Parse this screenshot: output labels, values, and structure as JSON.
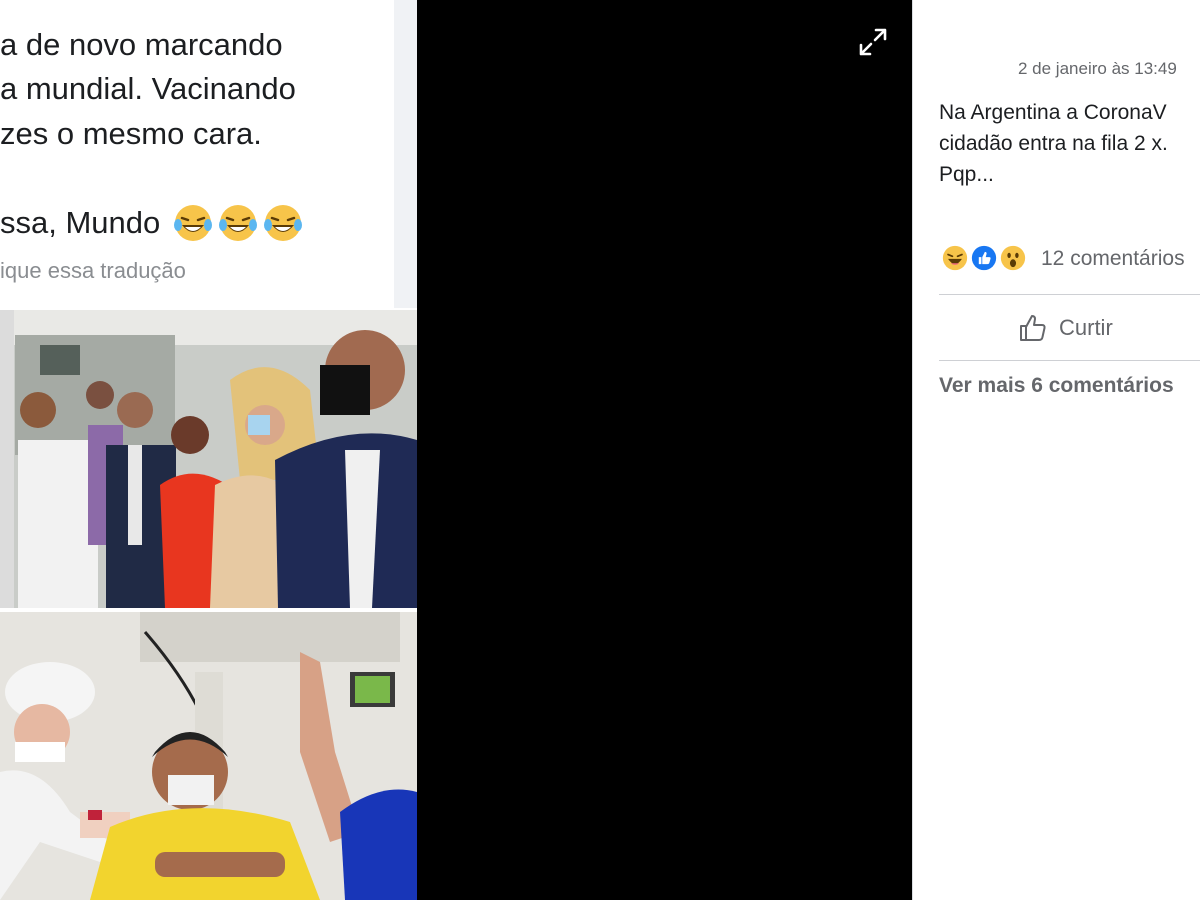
{
  "meme": {
    "line1": "a de novo marcando",
    "line2": "a mundial. Vacinando",
    "line3": "zes o mesmo cara.",
    "line4": "ssa, Mundo",
    "translate_note": "ique essa tradução",
    "laugh_icon": "tears-of-joy-emoji"
  },
  "viewer": {
    "expand_icon": "expand-icon"
  },
  "post": {
    "time": "2 de janeiro às 13:49",
    "line1": "Na Argentina a CoronaV",
    "line2": "cidadão entra na fila 2 x.",
    "line3": "Pqp...",
    "reactions": [
      "haha",
      "like",
      "wow"
    ],
    "comment_count": "12 comentários",
    "like_label": "Curtir",
    "more_comments": "Ver mais 6 comentários"
  },
  "colors": {
    "viewer_bg": "#000000",
    "like_blue": "#1877f2",
    "reaction_yellow": "#f7c44a",
    "secondary_text": "#65676b"
  }
}
